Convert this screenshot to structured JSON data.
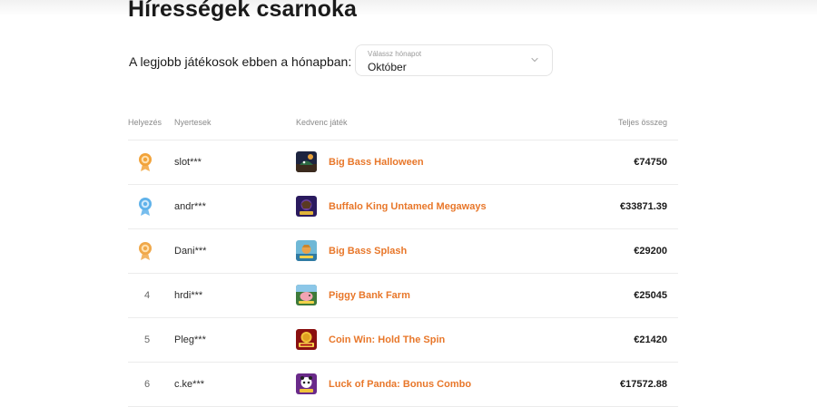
{
  "page": {
    "title": "Hírességek csarnoka"
  },
  "month_filter": {
    "label": "A legjobb játékosok ebben a hónapban:",
    "hint": "Válassz hónapot",
    "selected": "Október"
  },
  "table": {
    "headers": {
      "rank": "Helyezés",
      "winners": "Nyertesek",
      "favorite_game": "Kedvenc játék",
      "total": "Teljes összeg"
    },
    "rows": [
      {
        "rank": "1",
        "medal": "gold",
        "winner": "slot***",
        "game": "Big Bass Halloween",
        "thumb_icon": "big-bass-halloween-thumb",
        "amount": "€74750"
      },
      {
        "rank": "2",
        "medal": "silver",
        "winner": "andr***",
        "game": "Buffalo King Untamed Megaways",
        "thumb_icon": "buffalo-king-thumb",
        "amount": "€33871.39"
      },
      {
        "rank": "3",
        "medal": "bronze",
        "winner": "Dani***",
        "game": "Big Bass Splash",
        "thumb_icon": "big-bass-splash-thumb",
        "amount": "€29200"
      },
      {
        "rank": "4",
        "medal": "",
        "winner": "hrdi***",
        "game": "Piggy Bank Farm",
        "thumb_icon": "piggy-bank-farm-thumb",
        "amount": "€25045"
      },
      {
        "rank": "5",
        "medal": "",
        "winner": "Pleg***",
        "game": "Coin Win: Hold The Spin",
        "thumb_icon": "coin-win-thumb",
        "amount": "€21420"
      },
      {
        "rank": "6",
        "medal": "",
        "winner": "c.ke***",
        "game": "Luck of Panda: Bonus Combo",
        "thumb_icon": "luck-of-panda-thumb",
        "amount": "€17572.88"
      }
    ]
  },
  "colors": {
    "accent": "#e8772a",
    "gold": "#f2a33a",
    "silver": "#5fb2ea",
    "bronze": "#f0a84a",
    "divider": "#ececec"
  }
}
